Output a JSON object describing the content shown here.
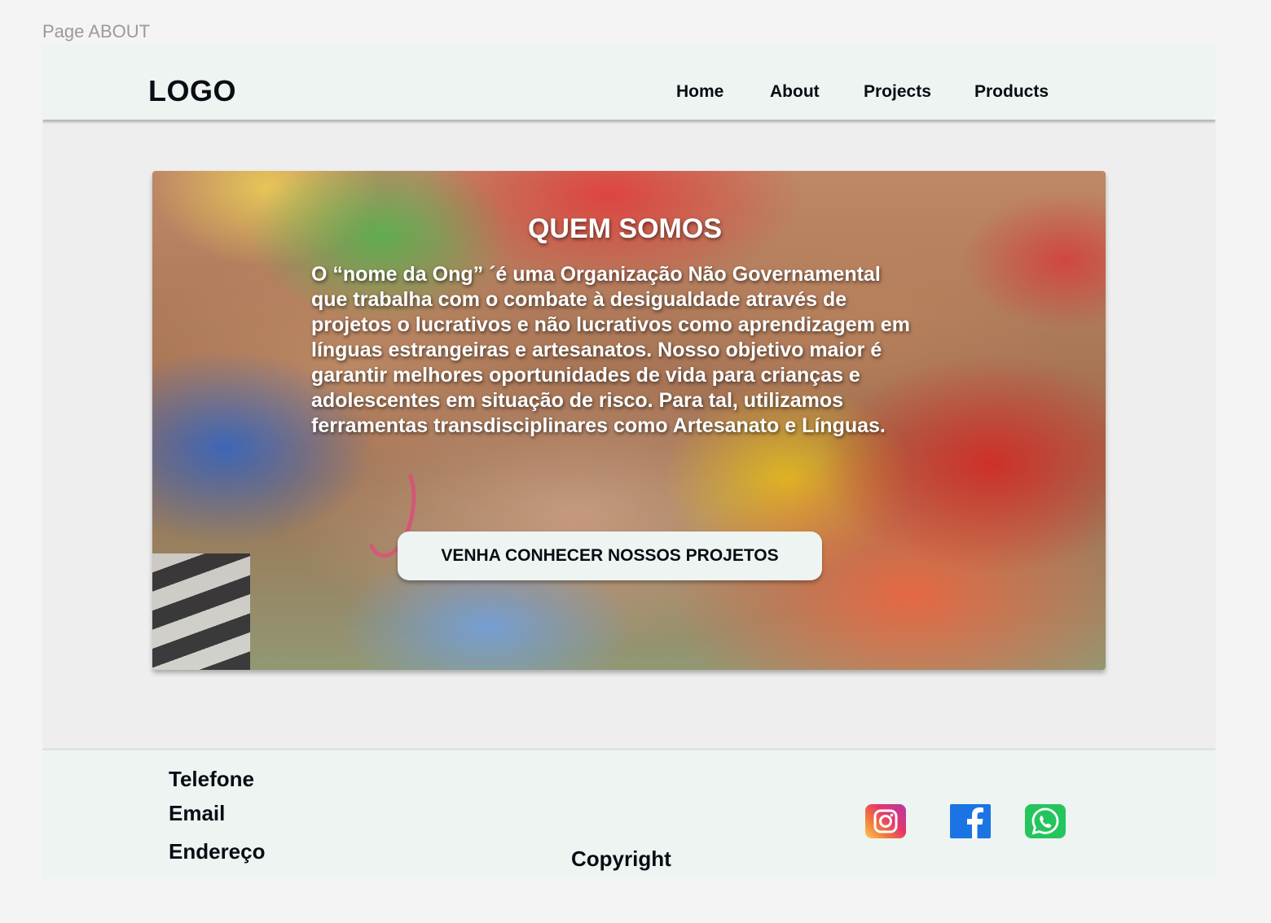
{
  "page_label": "Page ABOUT",
  "header": {
    "logo": "LOGO",
    "nav": [
      {
        "label": "Home"
      },
      {
        "label": "About"
      },
      {
        "label": "Projects"
      },
      {
        "label": "Products"
      }
    ]
  },
  "hero": {
    "title": "QUEM SOMOS",
    "text": "  O  “nome da Ong”  ´é uma  Organização Não Governamental\nque trabalha com o combate à desigualdade através de\nprojetos o lucrativos e não lucrativos como aprendizagem em\nlínguas estrangeiras e artesanatos. Nosso objetivo maior é\ngarantir melhores oportunidades de vida para crianças e\nadolescentes em situação de risco. Para tal, utilizamos\nferramentas transdisciplinares como Artesanato e Línguas.",
    "cta_label": "VENHA CONHECER NOSSOS PROJETOS",
    "image": "hands-together-photo"
  },
  "footer": {
    "telefone": "Telefone",
    "email": "Email",
    "endereco": "Endereço",
    "copyright": "Copyright",
    "social": [
      {
        "icon": "instagram-icon",
        "color": "#e5356a"
      },
      {
        "icon": "facebook-icon",
        "color": "#1b74e4"
      },
      {
        "icon": "whatsapp-icon",
        "color": "#24c55d"
      }
    ]
  }
}
